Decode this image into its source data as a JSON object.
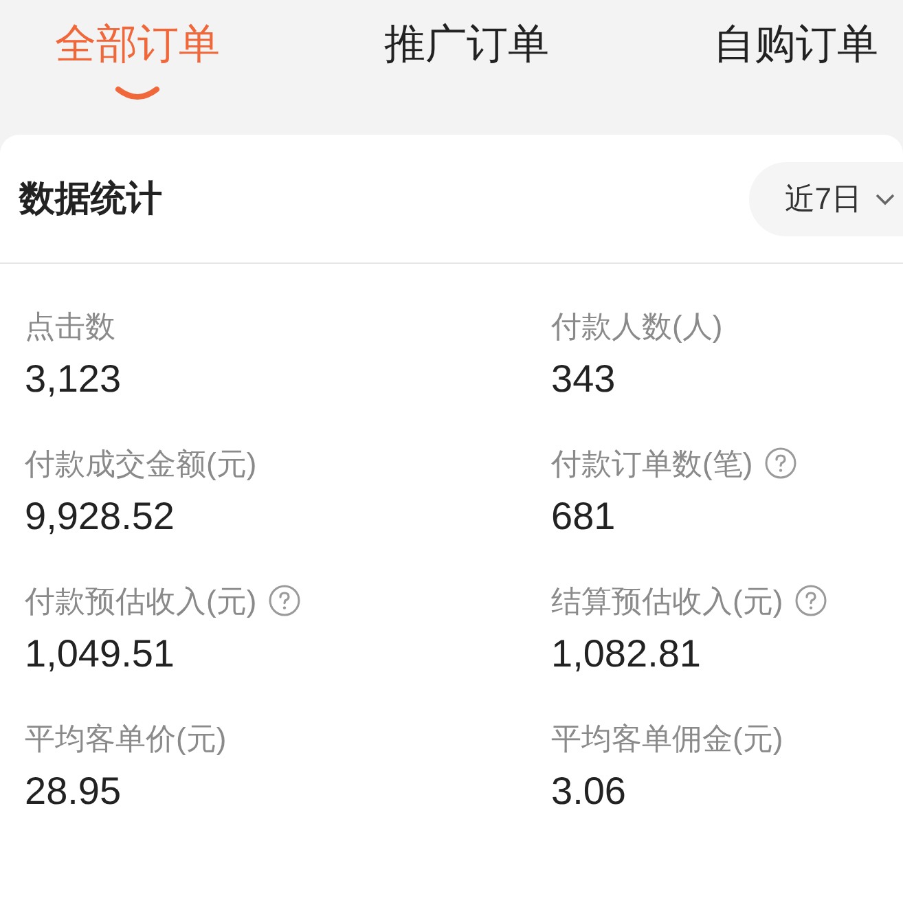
{
  "tabs": [
    {
      "label": "全部订单",
      "selected": true
    },
    {
      "label": "推广订单",
      "selected": false
    },
    {
      "label": "自购订单",
      "selected": false
    }
  ],
  "stats_card": {
    "title": "数据统计",
    "period_dropdown": {
      "value": "近7日"
    },
    "metrics": [
      {
        "label": "点击数",
        "value": "3,123",
        "help": false
      },
      {
        "label": "付款人数(人)",
        "value": "343",
        "help": false
      },
      {
        "label": "付款成交金额(元)",
        "value": "9,928.52",
        "help": false
      },
      {
        "label": "付款订单数(笔)",
        "value": "681",
        "help": true
      },
      {
        "label": "付款预估收入(元)",
        "value": "1,049.51",
        "help": true
      },
      {
        "label": "结算预估收入(元)",
        "value": "1,082.81",
        "help": true
      },
      {
        "label": "平均客单价(元)",
        "value": "28.95",
        "help": false
      },
      {
        "label": "平均客单佣金(元)",
        "value": "3.06",
        "help": false
      }
    ]
  }
}
